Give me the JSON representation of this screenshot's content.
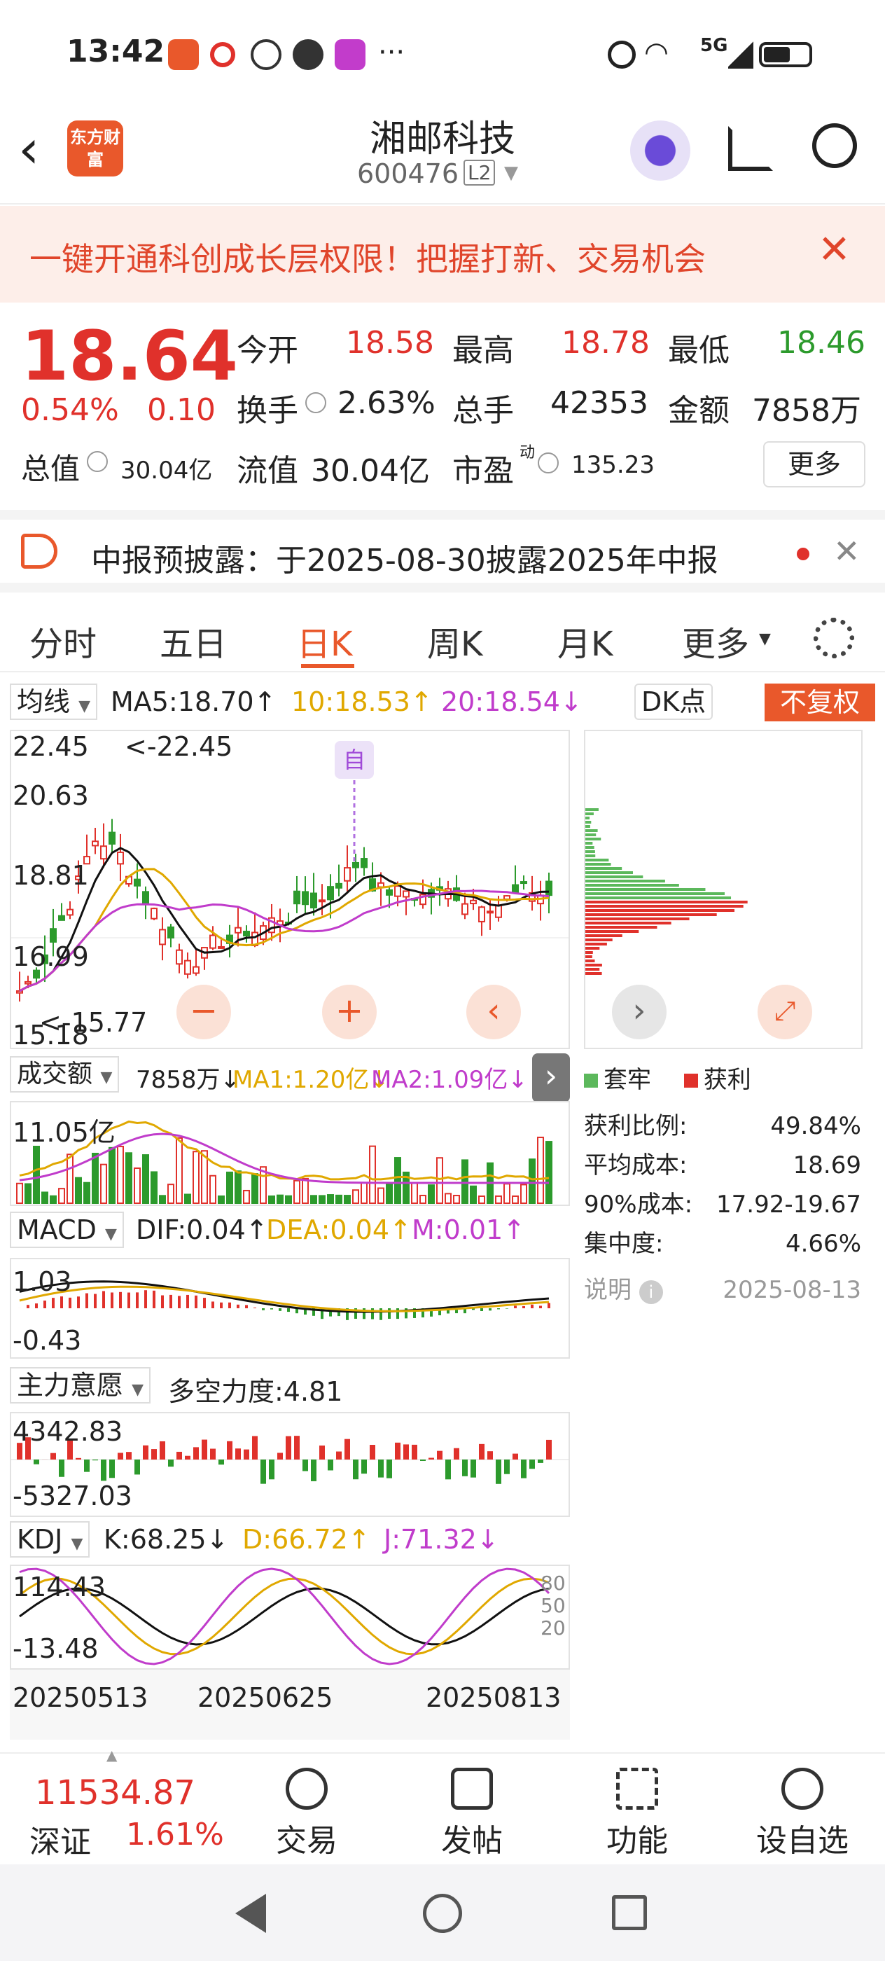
{
  "status": {
    "time": "13:42",
    "network": "5G"
  },
  "header": {
    "logo": "东方财富",
    "title": "湘邮科技",
    "code": "600476",
    "level": "L2"
  },
  "banner": {
    "text": "一键开通科创成长层权限！把握打新、交易机会"
  },
  "quote": {
    "price": "18.64",
    "change_pct": "0.54%",
    "change": "0.10",
    "open_label": "今开",
    "open": "18.58",
    "high_label": "最高",
    "high": "18.78",
    "low_label": "最低",
    "low": "18.46",
    "turnover_label": "换手",
    "turnover": "2.63%",
    "volume_label": "总手",
    "volume": "42353",
    "amount_label": "金额",
    "amount": "7858万",
    "mcap_label": "总值",
    "mcap": "30.04亿",
    "float_label": "流值",
    "float": "30.04亿",
    "pe_label": "市盈",
    "pe_sup": "动",
    "pe": "135.23",
    "more": "更多"
  },
  "notice": {
    "text": "中报预披露：于2025-08-30披露2025年中报"
  },
  "tabs": [
    "分时",
    "五日",
    "日K",
    "周K",
    "月K",
    "更多"
  ],
  "active_tab": "日K",
  "kline": {
    "indicator": "均线",
    "ma5": "MA5:18.70↑",
    "ma10": "10:18.53↑",
    "ma20": "20:18.54↓",
    "dk": "DK点",
    "fq": "不复权",
    "y_labels": [
      "22.45",
      "20.63",
      "18.81",
      "16.99",
      "15.18"
    ],
    "max_note": "<-22.45",
    "min_note": "<-15.77",
    "mark": "自"
  },
  "volume": {
    "indicator": "成交额",
    "value": "7858万↓",
    "ma1": "MA1:1.20亿↓",
    "ma2": "MA2:1.09亿↓",
    "y_top": "11.05亿"
  },
  "macd": {
    "indicator": "MACD",
    "dif": "DIF:0.04↑",
    "dea": "DEA:0.04↑",
    "m": "M:0.01↑",
    "y_top": "1.03",
    "y_bottom": "-0.43"
  },
  "main_force": {
    "indicator": "主力意愿",
    "label": "多空力度:4.81",
    "y_top": "4342.83",
    "y_bottom": "-5327.03"
  },
  "kdj": {
    "indicator": "KDJ",
    "k": "K:68.25↓",
    "d": "D:66.72↑",
    "j": "J:71.32↓",
    "y_top": "114.43",
    "y_bottom": "-13.48",
    "levels": [
      "80",
      "50",
      "20"
    ]
  },
  "dates": [
    "20250513",
    "20250625",
    "20250813"
  ],
  "chip": {
    "legend_trap": "套牢",
    "legend_profit": "获利",
    "rows": [
      {
        "k": "获利比例:",
        "v": "49.84%"
      },
      {
        "k": "平均成本:",
        "v": "18.69"
      },
      {
        "k": "90%成本:",
        "v": "17.92-19.67"
      },
      {
        "k": "集中度:",
        "v": "4.66%"
      }
    ],
    "note": "说明",
    "date": "2025-08-13"
  },
  "bottom": {
    "index_value": "11534.87",
    "index_name": "深证",
    "index_pct": "1.61%",
    "items": [
      "交易",
      "发帖",
      "功能",
      "设自选"
    ]
  },
  "colors": {
    "up": "#e0312b",
    "down": "#2c9a2c",
    "ma10": "#e0a800",
    "ma20": "#c03ccb",
    "accent": "#e9582b"
  }
}
